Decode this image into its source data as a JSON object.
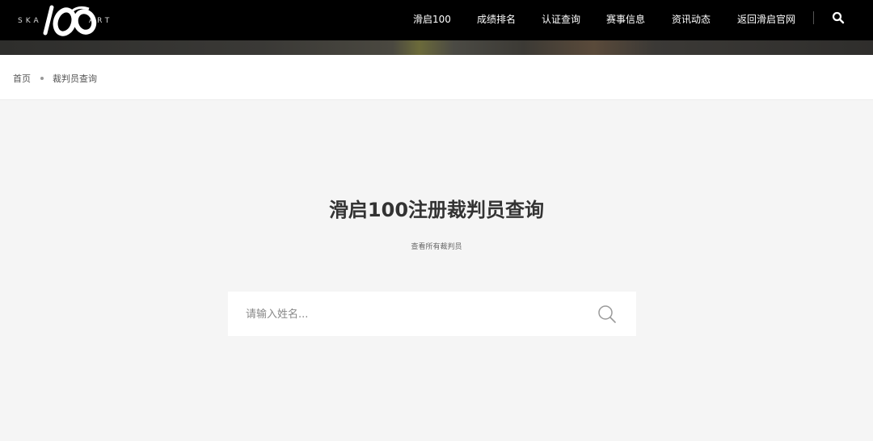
{
  "header": {
    "logo_text_left": "SKA",
    "logo_text_right": "ART",
    "nav": [
      "滑启100",
      "成绩排名",
      "认证查询",
      "赛事信息",
      "资讯动态",
      "返回滑启官网"
    ],
    "search_icon": "search-icon"
  },
  "breadcrumb": {
    "home": "首页",
    "current": "裁判员查询"
  },
  "main": {
    "title": "滑启100注册裁判员查询",
    "subtitle": "查看所有裁判员",
    "search": {
      "placeholder": "请输入姓名...",
      "value": "",
      "icon": "search-icon"
    }
  },
  "colors": {
    "header_bg": "#000000",
    "page_bg": "#f5f5f5",
    "card_bg": "#ffffff"
  }
}
